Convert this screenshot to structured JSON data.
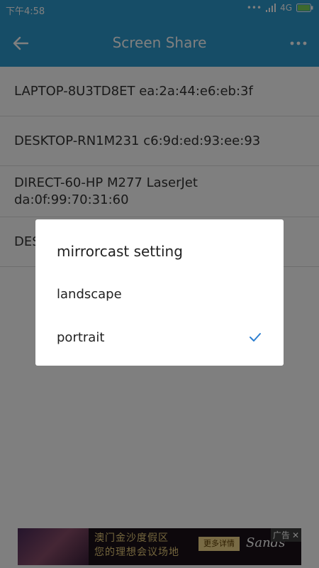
{
  "status_bar": {
    "time": "下午4:58",
    "dots": "•••",
    "network": "4G"
  },
  "app_bar": {
    "title": "Screen Share"
  },
  "devices": [
    {
      "label": "LAPTOP-8U3TD8ET ea:2a:44:e6:eb:3f"
    },
    {
      "label": "DESKTOP-RN1M231 c6:9d:ed:93:ee:93"
    },
    {
      "label": "DIRECT-60-HP M277 LaserJet da:0f:99:70:31:60"
    },
    {
      "label": "DES"
    }
  ],
  "dialog": {
    "title": "mirrorcast setting",
    "options": [
      {
        "label": "landscape",
        "selected": false
      },
      {
        "label": "portrait",
        "selected": true
      }
    ]
  },
  "ad": {
    "line1": "澳门金沙度假区",
    "line2": "您的理想会议场地",
    "cta": "更多详情",
    "brand": "Sands",
    "label": "广告",
    "close": "✕"
  },
  "colors": {
    "accent": "#2d9bcf",
    "check": "#2d7fd0"
  }
}
